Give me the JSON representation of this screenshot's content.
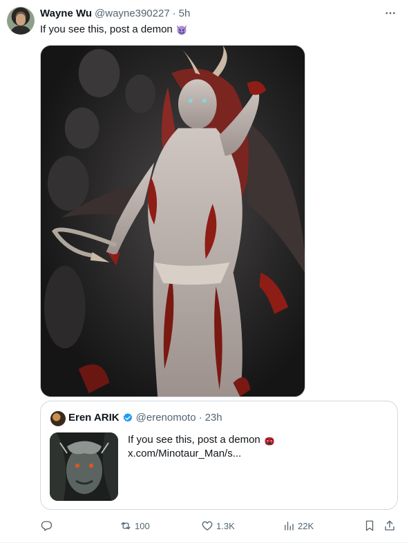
{
  "tweet": {
    "author_name": "Wayne Wu",
    "author_handle": "@wayne390227",
    "separator": "·",
    "time": "5h",
    "text": "If you see this, post a demon",
    "text_emoji": "smiling-devil-emoji",
    "media": {
      "icon": "image-demon-illustration"
    }
  },
  "quote": {
    "author_name": "Eren ARIK",
    "author_handle": "@erenomoto",
    "separator": "·",
    "time": "23h",
    "verified": true,
    "text_line1": "If you see this, post a demon",
    "text_line1_emoji": "ogre-emoji",
    "text_line2": "x.com/Minotaur_Man/s..."
  },
  "actions": {
    "reply_count": "",
    "retweet_count": "100",
    "like_count": "1.3K",
    "views_count": "22K"
  },
  "colors": {
    "secondary_text": "#536471",
    "primary_text": "#0f1419",
    "border": "#cfd9de",
    "verified_blue": "#1d9bf0"
  }
}
